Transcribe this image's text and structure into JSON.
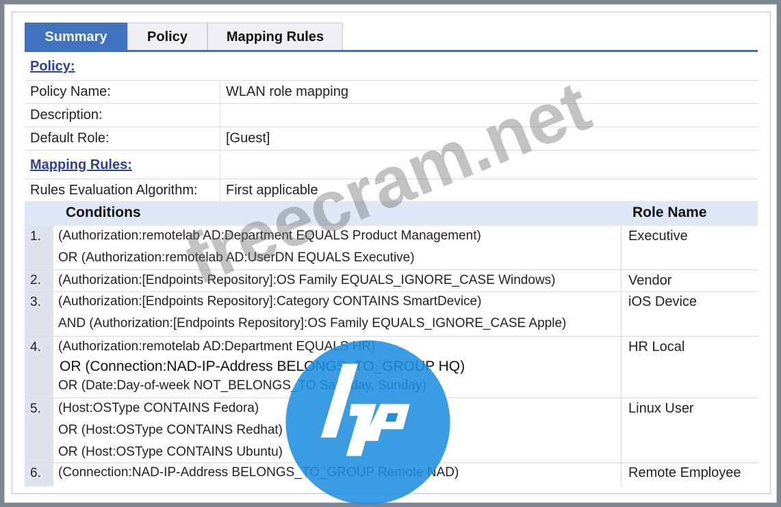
{
  "tabs": [
    {
      "label": "Summary",
      "active": true
    },
    {
      "label": "Policy",
      "active": false
    },
    {
      "label": "Mapping Rules",
      "active": false
    }
  ],
  "policy": {
    "section_title": "Policy:",
    "fields": [
      {
        "label": "Policy Name:",
        "value": "WLAN role mapping"
      },
      {
        "label": "Description:",
        "value": ""
      },
      {
        "label": "Default Role:",
        "value": "[Guest]"
      }
    ]
  },
  "mapping": {
    "section_title": "Mapping Rules:",
    "algorithm_label": "Rules Evaluation Algorithm:",
    "algorithm_value": "First applicable",
    "conditions_header": "Conditions",
    "role_header": "Role Name",
    "rules": [
      {
        "num": "1.",
        "lines": [
          "(Authorization:remotelab AD:Department EQUALS Product Management)",
          "OR (Authorization:remotelab AD:UserDN EQUALS Executive)"
        ],
        "role": "Executive"
      },
      {
        "num": "2.",
        "lines": [
          "(Authorization:[Endpoints Repository]:OS Family EQUALS_IGNORE_CASE Windows)"
        ],
        "role": "Vendor"
      },
      {
        "num": "3.",
        "lines": [
          "(Authorization:[Endpoints Repository]:Category CONTAINS SmartDevice)",
          "AND (Authorization:[Endpoints Repository]:OS Family EQUALS_IGNORE_CASE Apple)"
        ],
        "role": "iOS Device"
      },
      {
        "num": "4.",
        "lines": [
          "(Authorization:remotelab AD:Department EQUALS HR)",
          "OR (Connection:NAD-IP-Address BELONGS_TO_GROUP HQ)",
          "OR (Date:Day-of-week NOT_BELONGS_TO Saturday, Sunday)"
        ],
        "role": "HR Local"
      },
      {
        "num": "5.",
        "lines": [
          "(Host:OSType CONTAINS Fedora)",
          "OR (Host:OSType CONTAINS Redhat)",
          "OR (Host:OSType CONTAINS Ubuntu)"
        ],
        "role": "Linux User"
      },
      {
        "num": "6.",
        "lines": [
          "(Connection:NAD-IP-Address BELONGS_TO_GROUP Remote NAD)"
        ],
        "role": "Remote Employee"
      }
    ]
  },
  "watermark": {
    "text": "freecram.net",
    "logo": "hp-logo",
    "logo_color": "#1f8fe0"
  }
}
